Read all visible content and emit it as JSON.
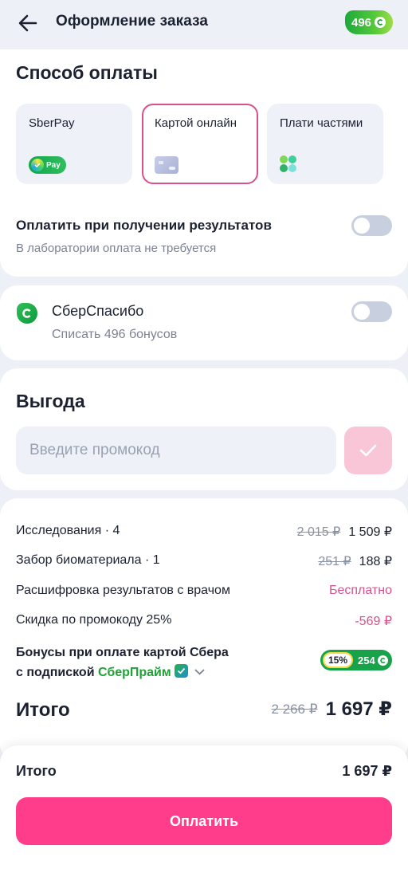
{
  "header": {
    "title": "Оформление заказа",
    "bonus_balance": "496"
  },
  "payment": {
    "title": "Способ оплаты",
    "methods": [
      {
        "label": "SberPay",
        "logo_text": "Pay",
        "selected": false
      },
      {
        "label": "Картой онлайн",
        "selected": true
      },
      {
        "label": "Плати частями",
        "selected": false
      }
    ],
    "pay_on_result": {
      "title": "Оплатить при получении результатов",
      "subtitle": "В лаборатории оплата не требуется",
      "enabled": false
    }
  },
  "spasibo": {
    "title": "СберСпасибо",
    "subtitle": "Списать 496 бонусов",
    "enabled": false
  },
  "benefit": {
    "title": "Выгода",
    "promo_placeholder": "Введите промокод"
  },
  "summary": {
    "lines": [
      {
        "label": "Исследования · 4",
        "old": "2 015 ₽",
        "value": "1 509 ₽"
      },
      {
        "label": "Забор биоматериала · 1",
        "old": "251 ₽",
        "value": "188 ₽"
      },
      {
        "label": "Расшифровка результатов с врачом",
        "value": "Бесплатно"
      },
      {
        "label": "Скидка по промокоду 25%",
        "value": "-569 ₽"
      }
    ],
    "bonus_line1": "Бонусы при оплате картой Сбера",
    "bonus_line2_prefix": "с подпиской",
    "bonus_prime": "СберПрайм",
    "bonus_percent": "15%",
    "bonus_value": "254",
    "total_label": "Итого",
    "total_old": "2 266 ₽",
    "total_value": "1 697 ₽"
  },
  "bottom": {
    "total_label": "Итого",
    "total_value": "1 697 ₽",
    "pay_button": "Оплатить"
  },
  "colors": {
    "accent_pink": "#ff3d8a",
    "selected_border": "#d9508f",
    "sber_green": "#21a038"
  }
}
